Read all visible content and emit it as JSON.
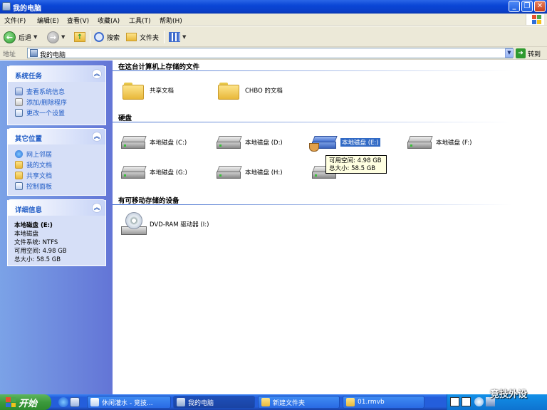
{
  "window": {
    "title": "我的电脑"
  },
  "menu": [
    "文件(F)",
    "编辑(E)",
    "查看(V)",
    "收藏(A)",
    "工具(T)",
    "帮助(H)"
  ],
  "toolbar": {
    "back_label": "后退",
    "search_label": "搜索",
    "folders_label": "文件夹"
  },
  "address": {
    "label": "地址",
    "value": "我的电脑",
    "go_label": "转到"
  },
  "left": {
    "system_tasks": {
      "title": "系统任务",
      "items": [
        "查看系统信息",
        "添加/删除程序",
        "更改一个设置"
      ]
    },
    "other_places": {
      "title": "其它位置",
      "items": [
        "网上邻居",
        "我的文档",
        "共享文档",
        "控制面板"
      ]
    },
    "details": {
      "title": "详细信息",
      "name": "本地磁盘 (E:)",
      "type": "本地磁盘",
      "fs": "文件系统: NTFS",
      "free": "可用空间: 4.98 GB",
      "total": "总大小: 58.5 GB"
    }
  },
  "main": {
    "group_files": "在这台计算机上存储的文件",
    "files": [
      "共享文档",
      "CHBO 的文档"
    ],
    "group_hdd": "硬盘",
    "drives": [
      "本地磁盘 (C:)",
      "本地磁盘 (D:)",
      "本地磁盘 (E:)",
      "本地磁盘 (F:)",
      "本地磁盘 (G:)",
      "本地磁盘 (H:)"
    ],
    "tooltip": {
      "free": "可用空间: 4.98 GB",
      "total": "总大小: 58.5 GB"
    },
    "group_removable": "有可移动存储的设备",
    "removable": [
      "DVD-RAM 驱动器 (I:)"
    ]
  },
  "taskbar": {
    "start": "开始",
    "tasks": [
      "休闲灌水 - 竞技...",
      "我的电脑",
      "新建文件夹",
      "01.rmvb"
    ]
  },
  "watermark": "竞技外设"
}
